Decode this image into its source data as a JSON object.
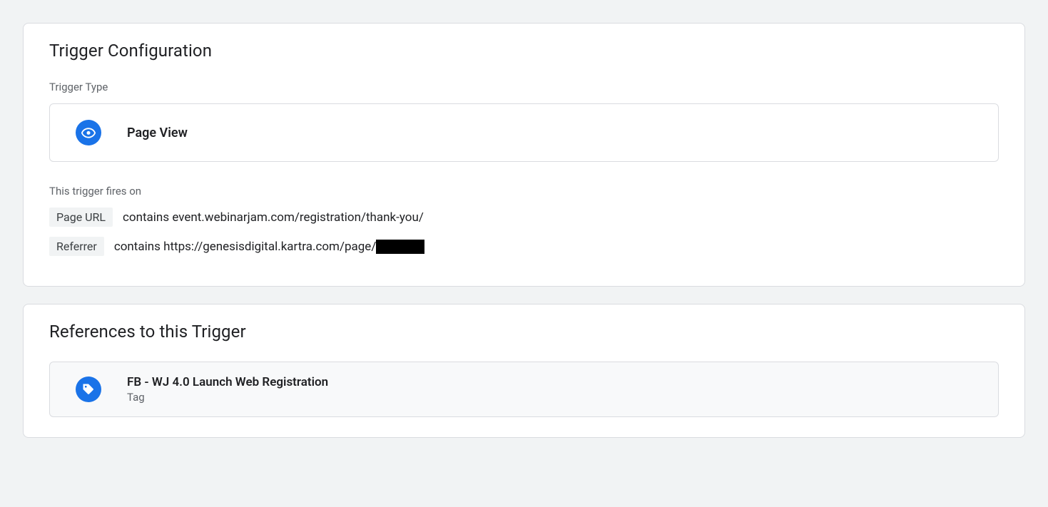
{
  "trigger": {
    "section_title": "Trigger Configuration",
    "type_label": "Trigger Type",
    "type_name": "Page View",
    "fires_on_label": "This trigger fires on",
    "conditions": [
      {
        "variable": "Page URL",
        "operator": "contains",
        "value": "event.webinarjam.com/registration/thank-you/",
        "redacted_suffix": false
      },
      {
        "variable": "Referrer",
        "operator": "contains",
        "value": "https://genesisdigital.kartra.com/page/",
        "redacted_suffix": true
      }
    ]
  },
  "references": {
    "section_title": "References to this Trigger",
    "items": [
      {
        "name": "FB - WJ 4.0 Launch Web Registration",
        "type": "Tag"
      }
    ]
  }
}
